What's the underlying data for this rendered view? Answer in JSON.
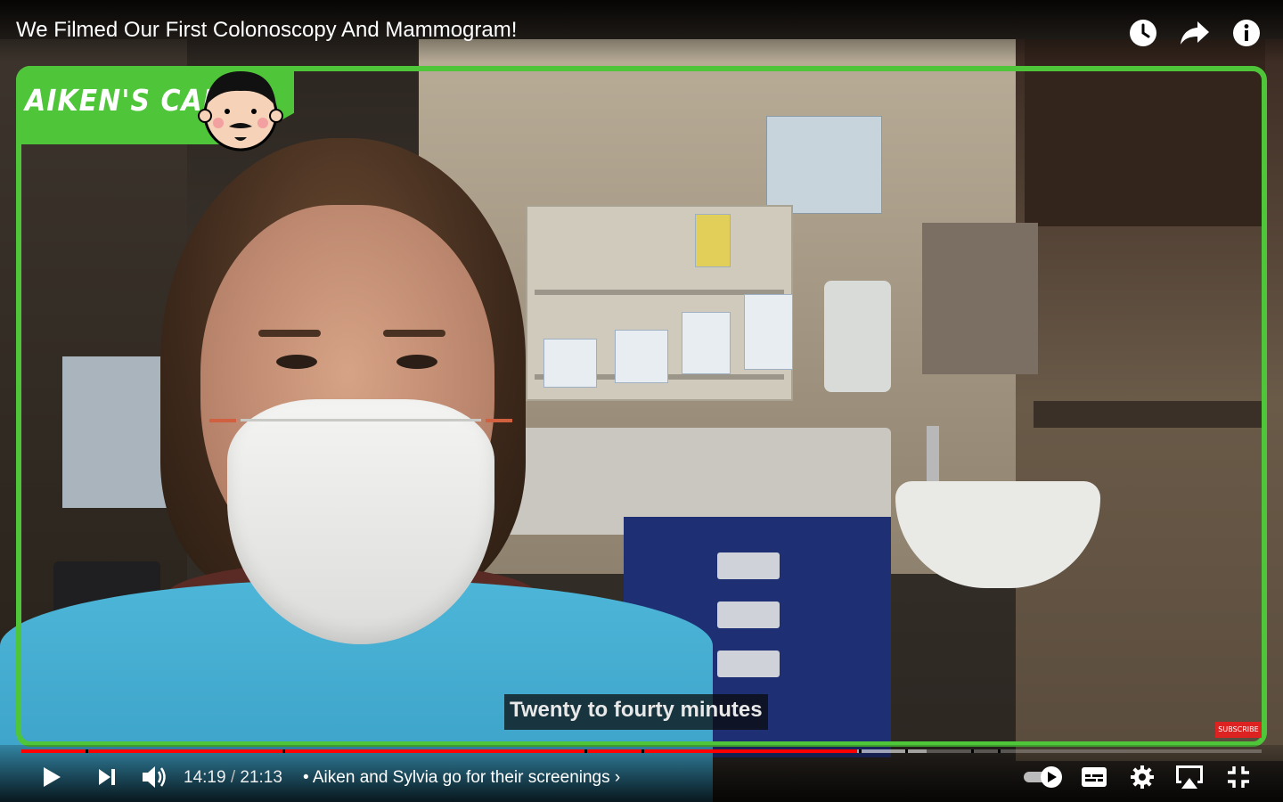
{
  "video": {
    "title": "We Filmed Our First Colonoscopy And Mammogram!",
    "caption": "Twenty to fourty minutes",
    "cam_label": "AIKEN'S CAM",
    "subscribe_label": "SUBSCRIBE",
    "frame_color": "#4fc53a"
  },
  "top_actions": [
    {
      "name": "watch-later",
      "icon": "clock-icon"
    },
    {
      "name": "share",
      "icon": "share-arrow-icon"
    },
    {
      "name": "info",
      "icon": "info-icon"
    }
  ],
  "player": {
    "current_time": "14:19",
    "separator": " / ",
    "duration": "21:13",
    "chapter": "• Aiken and Sylvia go for their screenings ›",
    "progress_played_fraction": 0.674,
    "progress_buffered_fraction": 0.73,
    "progress_color": "#ff0000",
    "autoplay_on": true
  }
}
